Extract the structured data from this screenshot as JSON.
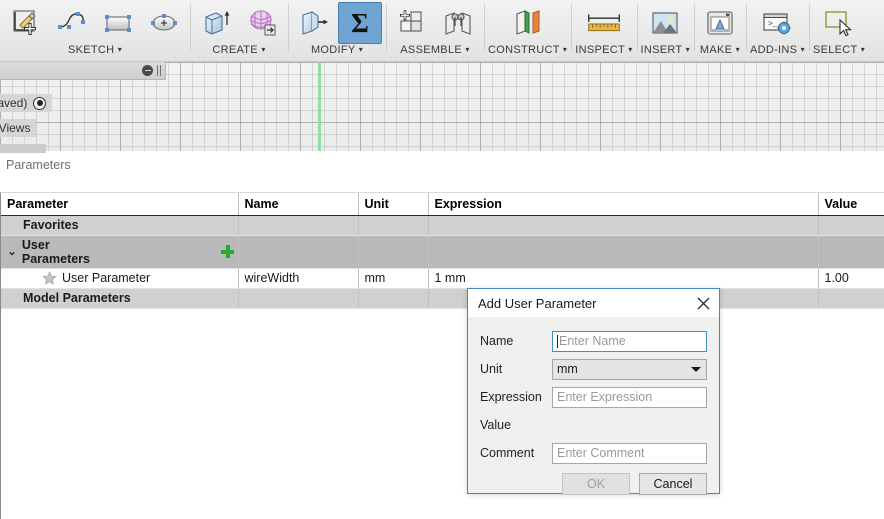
{
  "ribbon": {
    "groups": [
      {
        "label": "SKETCH",
        "caret": "▾",
        "icons": [
          "create-sketch-icon",
          "spline-icon",
          "rectangle-icon",
          "ellipse-icon"
        ]
      },
      {
        "label": "CREATE",
        "caret": "▾",
        "icons": [
          "extrude-icon",
          "coil-icon"
        ]
      },
      {
        "label": "MODIFY",
        "caret": "▾",
        "icons": [
          "press-pull-icon",
          "change-parameters-icon"
        ]
      },
      {
        "label": "ASSEMBLE",
        "caret": "▾",
        "icons": [
          "new-component-icon",
          "joint-icon"
        ]
      },
      {
        "label": "CONSTRUCT",
        "caret": "▾",
        "icons": [
          "offset-plane-icon"
        ]
      },
      {
        "label": "INSPECT",
        "caret": "▾",
        "icons": [
          "measure-icon"
        ]
      },
      {
        "label": "INSERT",
        "caret": "▾",
        "icons": [
          "insert-image-icon"
        ]
      },
      {
        "label": "MAKE",
        "caret": "▾",
        "icons": [
          "3d-print-icon"
        ]
      },
      {
        "label": "ADD-INS",
        "caret": "▾",
        "icons": [
          "scripts-addins-icon"
        ]
      },
      {
        "label": "SELECT",
        "caret": "▾",
        "icons": [
          "select-icon"
        ]
      }
    ]
  },
  "browser": {
    "document_label": "(Unsaved)",
    "named_views_label": "med Views"
  },
  "palette": {
    "title": "Parameters",
    "columns": [
      "Parameter",
      "Name",
      "Unit",
      "Expression",
      "Value"
    ],
    "rows": [
      {
        "kind": "group-light",
        "parameter": "Favorites",
        "name": "",
        "unit": "",
        "expression": "",
        "value": ""
      },
      {
        "kind": "group-dark",
        "parameter": "User Parameters",
        "name": "",
        "unit": "",
        "expression": "",
        "value": "",
        "chevron": "⌄",
        "add_icon": "add-parameter-icon"
      },
      {
        "kind": "data",
        "parameter": "User Parameter",
        "name": "wireWidth",
        "unit": "mm",
        "expression": "1 mm",
        "value": "1.00",
        "favorite_icon": "star-icon"
      },
      {
        "kind": "group-light",
        "parameter": "Model Parameters",
        "name": "",
        "unit": "",
        "expression": "",
        "value": ""
      }
    ]
  },
  "dialog": {
    "title": "Add User Parameter",
    "close_icon": "close-icon",
    "fields": {
      "name_label": "Name",
      "name_placeholder": "Enter Name",
      "name_value": "",
      "unit_label": "Unit",
      "unit_value": "mm",
      "expression_label": "Expression",
      "expression_placeholder": "Enter Expression",
      "expression_value": "",
      "value_label": "Value",
      "value_text": "",
      "comment_label": "Comment",
      "comment_placeholder": "Enter Comment",
      "comment_value": ""
    },
    "ok_label": "OK",
    "cancel_label": "Cancel"
  },
  "colors": {
    "accent": "#4a86b8",
    "add_green": "#2aa832",
    "active_tool": "#6fa3d2",
    "axis_green": "#8fdc9e"
  }
}
